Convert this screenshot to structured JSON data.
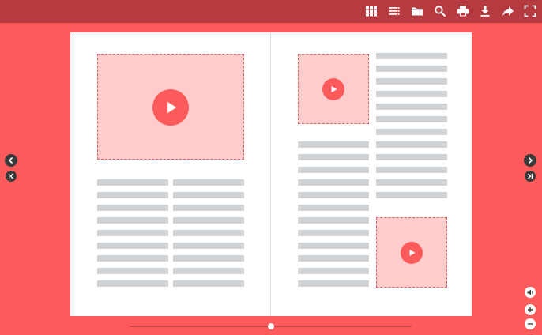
{
  "toolbar": {
    "icons": [
      "thumbnails-grid-icon",
      "table-of-contents-icon",
      "folder-icon",
      "search-icon",
      "print-icon",
      "download-icon",
      "share-icon",
      "fullscreen-icon"
    ]
  },
  "navigation": {
    "icons": [
      "chevron-left-icon",
      "first-page-icon",
      "chevron-right-icon",
      "last-page-icon"
    ]
  },
  "controls": {
    "icons": [
      "sound-icon",
      "zoom-in-icon",
      "zoom-out-icon"
    ]
  },
  "page_slider": {
    "position": 0.5
  },
  "colors": {
    "background": "#fd5b5b",
    "toolbar": "#b53b40",
    "page": "#ffffff",
    "media_placeholder": "#ffcccc",
    "text_line": "#d0d4d7"
  }
}
